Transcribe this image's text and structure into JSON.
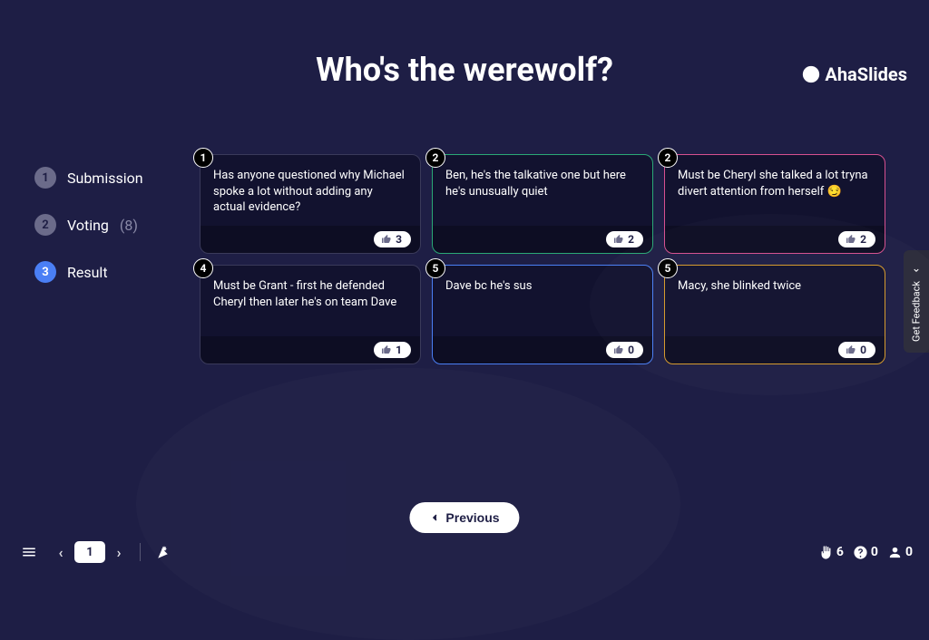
{
  "brand": "AhaSlides",
  "title": "Who's the werewolf?",
  "steps": [
    {
      "num": "1",
      "label": "Submission",
      "active": false
    },
    {
      "num": "2",
      "label": "Voting",
      "count": "(8)",
      "active": false
    },
    {
      "num": "3",
      "label": "Result",
      "active": true
    }
  ],
  "cards": [
    {
      "rank": "1",
      "text": "Has anyone questioned why Michael spoke a lot without adding any actual evidence?",
      "votes": "3",
      "border": ""
    },
    {
      "rank": "2",
      "text": "Ben, he's the talkative one but here he's unusually quiet",
      "votes": "2",
      "border": "bc-green"
    },
    {
      "rank": "2",
      "text": "Must be Cheryl she talked a lot tryna divert attention from herself 😏",
      "votes": "2",
      "border": "bc-pink"
    },
    {
      "rank": "4",
      "text": "Must be Grant - first he defended Cheryl then later he's on team Dave",
      "votes": "1",
      "border": ""
    },
    {
      "rank": "5",
      "text": "Dave bc he's sus",
      "votes": "0",
      "border": "bc-blue"
    },
    {
      "rank": "5",
      "text": "Macy, she blinked twice",
      "votes": "0",
      "border": "bc-orange"
    }
  ],
  "prev_button": "Previous",
  "feedback_tab": "Get Feedback",
  "bottom": {
    "page": "1",
    "hands": "6",
    "questions": "0",
    "people": "0"
  }
}
